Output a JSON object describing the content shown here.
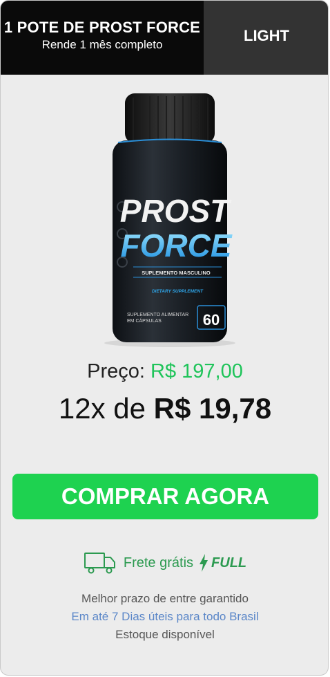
{
  "header": {
    "title": "1 POTE DE PROST FORCE",
    "subtitle": "Rende 1 mês completo",
    "tab_label": "LIGHT"
  },
  "product": {
    "brand_line1": "PROST",
    "brand_line2": "FORCE",
    "tagline": "SUPLEMENTO MASCULINO",
    "label": "DIETARY SUPPLEMENT",
    "note_line1": "SUPLEMENTO ALIMENTAR",
    "note_line2": "EM CÁPSULAS",
    "count": "60"
  },
  "pricing": {
    "label": "Preço:",
    "price": "R$ 197,00",
    "installment_prefix": "12x de",
    "installment_value": "R$ 19,78"
  },
  "cta": {
    "label": "COMPRAR AGORA"
  },
  "shipping": {
    "text": "Frete grátis",
    "badge": "FULL",
    "line1": "Melhor prazo de entre garantido",
    "line2": "Em até 7 Dias úteis para todo Brasil",
    "line3": "Estoque disponível"
  },
  "colors": {
    "accent_green": "#1ed250",
    "price_green": "#1fc45a",
    "link_blue": "#5a86c8"
  }
}
